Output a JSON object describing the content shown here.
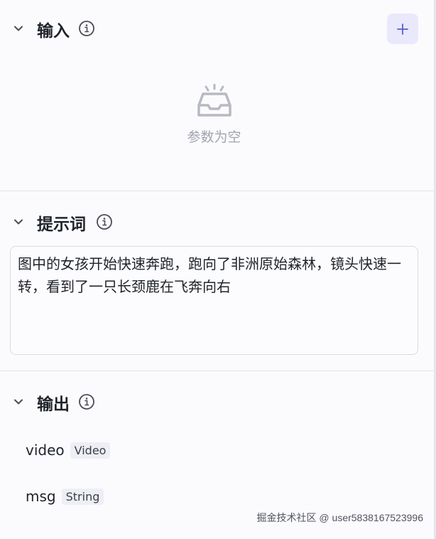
{
  "input_section": {
    "title": "输入",
    "add_label": "+",
    "empty_text": "参数为空"
  },
  "prompt_section": {
    "title": "提示词",
    "text": "图中的女孩开始快速奔跑，跑向了非洲原始森林，镜头快速一转，看到了一只长颈鹿在飞奔向右"
  },
  "output_section": {
    "title": "输出",
    "items": [
      {
        "name": "video",
        "type": "Video"
      },
      {
        "name": "msg",
        "type": "String"
      }
    ]
  },
  "watermark": "掘金技术社区 @ user5838167523996",
  "colors": {
    "accent": "#5b5bd6",
    "add_bg": "#e9e9fb"
  }
}
